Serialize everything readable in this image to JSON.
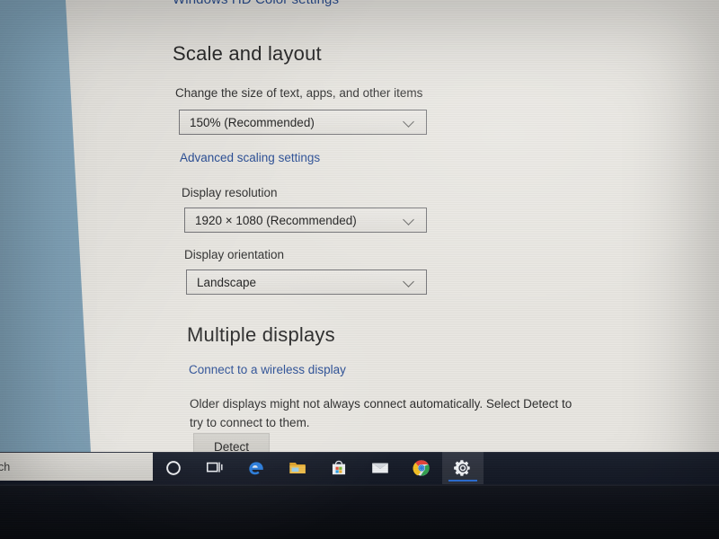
{
  "window": {
    "cut_top_link": "Windows HD Color settings"
  },
  "scale_section": {
    "heading": "Scale and layout",
    "scale_label": "Change the size of text, apps, and other items",
    "scale_value": "150% (Recommended)",
    "advanced_link": "Advanced scaling settings",
    "resolution_label": "Display resolution",
    "resolution_value": "1920 × 1080 (Recommended)",
    "orientation_label": "Display orientation",
    "orientation_value": "Landscape"
  },
  "multiple_displays": {
    "heading": "Multiple displays",
    "wireless_link": "Connect to a wireless display",
    "description": "Older displays might not always connect automatically. Select Detect to try to connect to them.",
    "detect_button": "Detect"
  },
  "taskbar": {
    "search_text": "ch",
    "search_placeholder": "Type here to search",
    "items": [
      {
        "name": "cortana",
        "label": "Cortana"
      },
      {
        "name": "task-view",
        "label": "Task View"
      },
      {
        "name": "edge",
        "label": "Microsoft Edge"
      },
      {
        "name": "file-explorer",
        "label": "File Explorer"
      },
      {
        "name": "microsoft-store",
        "label": "Microsoft Store"
      },
      {
        "name": "mail",
        "label": "Mail"
      },
      {
        "name": "chrome",
        "label": "Google Chrome"
      },
      {
        "name": "settings",
        "label": "Settings"
      }
    ],
    "active_item": "settings"
  },
  "colors": {
    "wallpaper": "#7fa1b6",
    "settings_bg": "#e9e7e2",
    "link": "#2b4f96",
    "taskbar": "#171c28",
    "accent_underline": "#2d6fd4"
  }
}
